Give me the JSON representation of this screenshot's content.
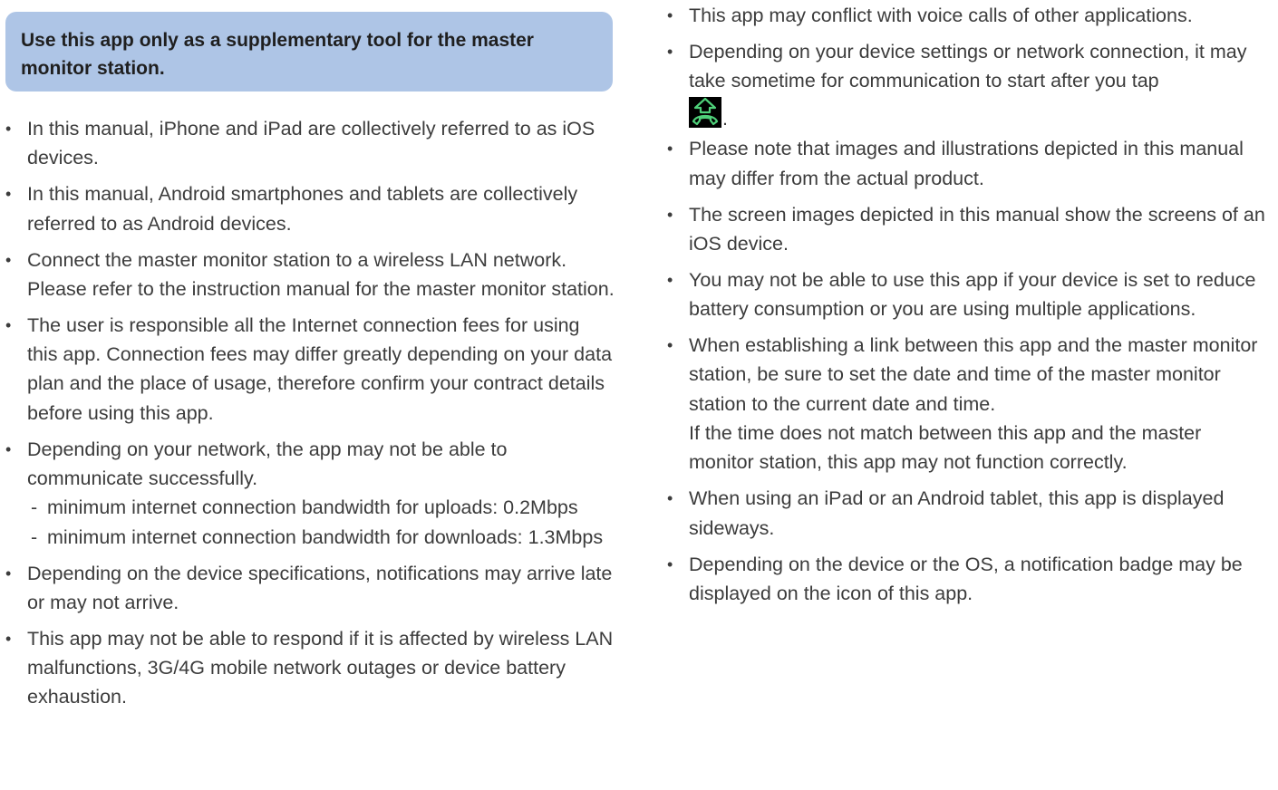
{
  "callout": {
    "text": "Use this app only as a supplementary tool for the master monitor station."
  },
  "left_bullets": [
    "In this manual, iPhone and iPad are collectively referred to as iOS devices.",
    "In this manual, Android smartphones and tablets are collectively referred to as Android devices.",
    "Connect the master monitor station to a wireless LAN network. Please refer to the instruction manual for the master monitor station.",
    "The user is responsible all the Internet connection fees for using this app. Connection fees may differ greatly depending on your data plan and the place of usage, therefore confirm your contract details before using this app.",
    "Depending on your network, the app may not be able to communicate successfully.",
    "Depending on the device specifications, notifications may arrive late or may not arrive.",
    "This app may not be able to respond if it is affected by wireless LAN malfunctions, 3G/4G mobile network outages or device battery exhaustion."
  ],
  "bandwidth": {
    "upload": "minimum internet connection bandwidth for uploads: 0.2Mbps",
    "download": "minimum internet connection bandwidth for downloads: 1.3Mbps"
  },
  "right_bullets": [
    "This app may conflict with voice calls of other applications.",
    "Depending on your device settings or network connection, it may take sometime for communication to start after you tap",
    "Please note that images and illustrations depicted in this manual may differ from the actual product.",
    "The screen images depicted in this manual show the screens of an iOS device.",
    "You may not be able to use this app if your device is set to reduce battery consumption or you are using multiple applications.",
    "When establishing a link between this app and the master monitor station, be sure to set the date and time of the master monitor station to the current date and time.",
    "When using an iPad or an Android tablet, this app is displayed sideways.",
    "Depending on the device or the OS, a notification badge may be displayed on the icon of this app."
  ],
  "time_note": "If the time does not match between this app and the master monitor station, this app may not function correctly.",
  "tap_icon": {
    "name": "call-answer-icon",
    "period": ".",
    "color_arrow": "#4fd17a",
    "color_background": "#000000"
  }
}
